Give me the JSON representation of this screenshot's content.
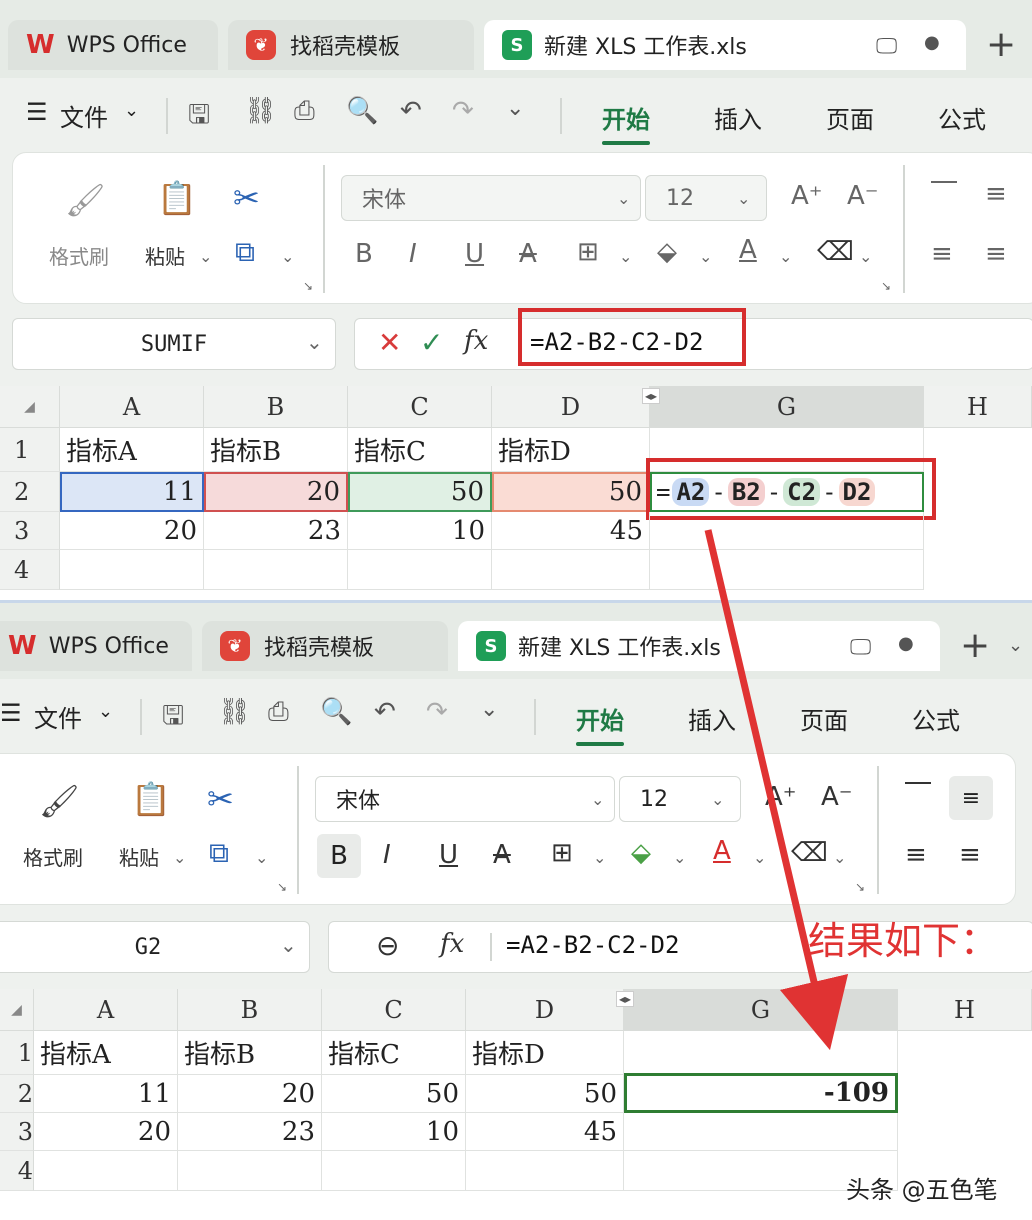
{
  "top": {
    "tabs": {
      "wps": "WPS Office",
      "template": "找稻壳模板",
      "file": "新建 XLS 工作表.xls"
    },
    "menu": {
      "file": "文件",
      "items": [
        "开始",
        "插入",
        "页面",
        "公式"
      ]
    },
    "ribbon": {
      "format_painter": "格式刷",
      "paste": "粘贴",
      "font_name": "宋体",
      "font_size": "12"
    },
    "name_box": "SUMIF",
    "formula": "=A2-B2-C2-D2",
    "columns": [
      "A",
      "B",
      "C",
      "D",
      "G",
      "H"
    ],
    "rows": [
      "1",
      "2",
      "3",
      "4"
    ],
    "headers": [
      "指标A",
      "指标B",
      "指标C",
      "指标D"
    ],
    "row2": [
      "11",
      "20",
      "50",
      "50"
    ],
    "row3": [
      "20",
      "23",
      "10",
      "45"
    ],
    "g2_refs": [
      "A2",
      "B2",
      "C2",
      "D2"
    ]
  },
  "bottom": {
    "tabs": {
      "wps": "WPS Office",
      "template": "找稻壳模板",
      "file": "新建 XLS 工作表.xls"
    },
    "menu": {
      "file": "文件",
      "items": [
        "开始",
        "插入",
        "页面",
        "公式"
      ]
    },
    "ribbon": {
      "format_painter": "格式刷",
      "paste": "粘贴",
      "font_name": "宋体",
      "font_size": "12"
    },
    "name_box": "G2",
    "formula": "=A2-B2-C2-D2",
    "columns": [
      "A",
      "B",
      "C",
      "D",
      "G",
      "H"
    ],
    "rows": [
      "1",
      "2",
      "3",
      "4"
    ],
    "headers": [
      "指标A",
      "指标B",
      "指标C",
      "指标D"
    ],
    "row2": [
      "11",
      "20",
      "50",
      "50"
    ],
    "row3": [
      "20",
      "23",
      "10",
      "45"
    ],
    "result": "-109"
  },
  "annotation": "结果如下：",
  "watermark": "头条 @五色笔",
  "colors": {
    "accent_green": "#1f7a45",
    "annotation_red": "#e03333",
    "ref_a": "#c9daf4",
    "ref_b": "#f4cfcf",
    "ref_c": "#cfe8d5",
    "ref_d": "#f7d7d0"
  }
}
